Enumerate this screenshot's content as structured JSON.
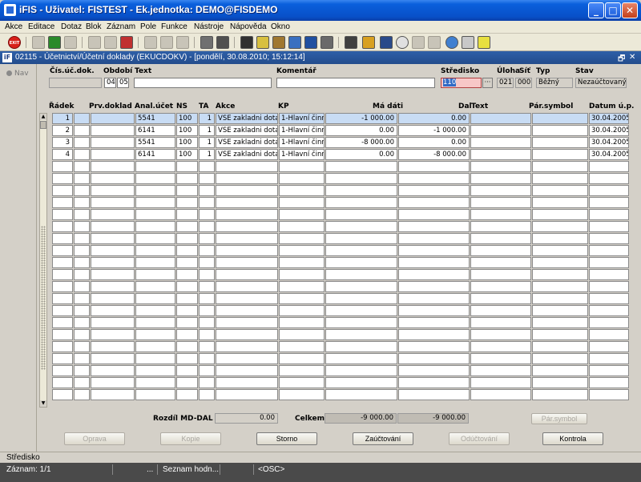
{
  "app": {
    "title": "iFIS - Uživatel: FISTEST - Ek.jednotka: DEMO@FISDEMO",
    "controls": {
      "minimize": "_",
      "maximize": "□",
      "close": "✕"
    }
  },
  "menu": [
    "Akce",
    "Editace",
    "Dotaz",
    "Blok",
    "Záznam",
    "Pole",
    "Funkce",
    "Nástroje",
    "Nápověda",
    "Okno"
  ],
  "toolbar": {
    "exit_label": "EXIT",
    "icons": [
      "exit-icon",
      "send-icon",
      "save-icon",
      "delete-icon",
      "print-preview-icon",
      "copy-icon",
      "delete-record-icon",
      "sort-asc-icon",
      "sort-desc-icon",
      "filter-icon",
      "print-icon",
      "export-icon",
      "cut-icon",
      "copy-icon",
      "paste-icon",
      "find-icon",
      "list-icon",
      "attach-icon",
      "calculator-icon",
      "chart-icon",
      "clock-icon",
      "checkbox-icon",
      "mail-icon",
      "refresh-icon",
      "lock-icon",
      "help-icon"
    ]
  },
  "inner_window": {
    "icon_label": "iF",
    "title": "02115 - Účetnictví/Účetní doklady (EKUCDOKV) - [pondělí, 30.08.2010; 15:12:14]",
    "controls": {
      "restore": "🗗",
      "close": "✕"
    }
  },
  "nav": {
    "label": "Nav"
  },
  "header": {
    "labels": {
      "cis_uc_dok": "Čís.úč.dok.",
      "obdobi": "Období",
      "text": "Text",
      "komentar": "Komentář",
      "stredisko": "Středisko",
      "uloha": "Úloha",
      "sit": "Síť",
      "typ": "Typ",
      "stav": "Stav"
    },
    "values": {
      "cis_uc_dok": "",
      "obdobi_month": "04",
      "obdobi_year": "05",
      "text": "",
      "komentar": "",
      "stredisko": "110",
      "stredisko_lov": "···",
      "uloha": "021",
      "sit": "000",
      "typ": "Běžný",
      "stav": "Nezaúčtovaný"
    }
  },
  "grid": {
    "columns": [
      "Řádek",
      "Prv.doklad",
      "Anal.účet",
      "NS",
      "TA",
      "Akce",
      "KP",
      "Má dáti",
      "Dal",
      "Text",
      "Pár.symbol",
      "Datum ú.p."
    ],
    "rows": [
      [
        "1",
        "",
        "5541",
        "100",
        "1",
        "VSE zakladni dotace",
        "1-Hlavní činnost",
        "-1 000.00",
        "0.00",
        "",
        "",
        "30.04.2005"
      ],
      [
        "2",
        "",
        "6141",
        "100",
        "1",
        "VSE zakladni dotace",
        "1-Hlavní činnost",
        "0.00",
        "-1 000.00",
        "",
        "",
        "30.04.2005"
      ],
      [
        "3",
        "",
        "5541",
        "100",
        "1",
        "VSE zakladni dotace",
        "1-Hlavní činnost",
        "-8 000.00",
        "0.00",
        "",
        "",
        "30.04.2005"
      ],
      [
        "4",
        "",
        "6141",
        "100",
        "1",
        "VSE zakladni dotace",
        "1-Hlavní činnost",
        "0.00",
        "-8 000.00",
        "",
        "",
        "30.04.2005"
      ]
    ]
  },
  "totals": {
    "rozdil_label": "Rozdíl MD-DAL",
    "rozdil_value": "0.00",
    "celkem_label": "Celkem",
    "celkem_md": "-9 000.00",
    "celkem_dal": "-9 000.00",
    "par_symbol_button": "Pár.symbol"
  },
  "buttons": {
    "oprava": "Oprava",
    "kopie": "Kopie",
    "storno": "Storno",
    "zauctovani": "Zaúčtování",
    "oductovani": "Odúčtování",
    "kontrola": "Kontrola"
  },
  "status": {
    "line1": "Středisko",
    "zaznam": "Záznam: 1/1",
    "ellipsis": "...",
    "seznam": "Seznam hodn...",
    "osc": "<OSC>"
  }
}
